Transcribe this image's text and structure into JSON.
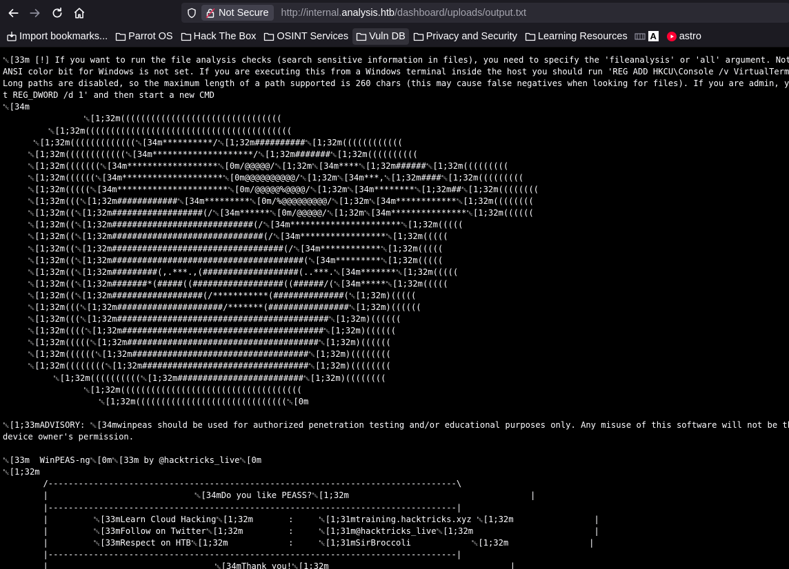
{
  "browser": {
    "security_label": "Not Secure",
    "url_prefix": "http://internal.",
    "url_host": "analysis.htb",
    "url_path": "/dashboard/uploads/output.txt"
  },
  "bookmarks": [
    {
      "label": "Import bookmarks...",
      "icon": "import-icon"
    },
    {
      "label": "Parrot OS",
      "icon": "folder-icon"
    },
    {
      "label": "Hack The Box",
      "icon": "folder-icon"
    },
    {
      "label": "OSINT Services",
      "icon": "folder-icon"
    },
    {
      "label": "Vuln DB",
      "icon": "folder-icon"
    },
    {
      "label": "Privacy and Security",
      "icon": "folder-icon"
    },
    {
      "label": "Learning Resources",
      "icon": "folder-icon"
    },
    {
      "label": "astro",
      "icon": "youtube-icon"
    }
  ],
  "document": {
    "lines": [
      "␛[33m [!] If you want to run the file analysis checks (search sensitive information in files), you need to specify the 'fileanalysis' or 'all' argument. Note this",
      "ANSI color bit for Windows is not set. If you are executing this from a Windows terminal inside the host you should run 'REG ADD HKCU\\Console /v VirtualTerminalLevel",
      "Long paths are disabled, so the maximum length of a path supported is 260 chars (this may cause false negatives when looking for files). If you are admin, you can",
      "t REG_DWORD /d 1' and then start a new CMD",
      "␛[34m",
      "                ␛[1;32m((((((((((((((((((((((((((((((((",
      "         ␛[1;32m(((((((((((((((((((((((((((((((((((((((((",
      "      ␛[1;32m(((((((((((((␛[34m**********/␛[1;32m##########␛[1;32m((((((((((((",
      "     ␛[1;32m((((((((((((␛[34m********************/␛[1;32m#######␛[1;32m((((((((((",
      "     ␛[1;32m(((((((␛[34m******************␛[0m/@@@@@/␛[1;32m␛[34m****␛[1;32m######␛[1;32m(((((((((",
      "     ␛[1;32m((((((␛[34m********************␛[0m@@@@@@@@@@/␛[1;32m␛[34m***,␛[1;32m####␛[1;32m(((((((((",
      "     ␛[1;32m(((((␛[34m**********************␛[0m/@@@@@%@@@@/␛[1;32m␛[34m********␛[1;32m##␛[1;32m((((((((",
      "     ␛[1;32m(((␛[1;32m############␛[34m*********␛[0m/%@@@@@@@@@/␛[1;32m␛[34m************␛[1;32m((((((((",
      "     ␛[1;32m((␛[1;32m##################(/␛[34m******␛[0m/@@@@@/␛[1;32m␛[34m***************␛[1;32m((((((",
      "     ␛[1;32m((␛[1;32m############################(/␛[34m**********************␛[1;32m(((((",
      "     ␛[1;32m((␛[1;32m##############################(/␛[34m*****************␛[1;32m(((((",
      "     ␛[1;32m((␛[1;32m##################################(/␛[34m************␛[1;32m(((((",
      "     ␛[1;32m((␛[1;32m######################################(␛[34m*********␛[1;32m(((((",
      "     ␛[1;32m((␛[1;32m#########(,.***.,(###################(..***.␛[34m*******␛[1;32m(((((",
      "     ␛[1;32m((␛[1;32m#######*(#####((##################((######/(␛[34m*****␛[1;32m(((((",
      "     ␛[1;32m((␛[1;32m##################(/***********(##############(␛[1;32m)(((((",
      "     ␛[1;32m(((␛[1;32m#####################/*******(################␛[1;32m)((((((",
      "     ␛[1;32m(((␛[1;32m##########################################␛[1;32m)((((((",
      "     ␛[1;32m((((␛[1;32m########################################␛[1;32m)((((((",
      "     ␛[1;32m(((((␛[1;32m######################################␛[1;32m)((((((",
      "     ␛[1;32m((((((␛[1;32m###################################␛[1;32m)((((((((",
      "     ␛[1;32m((((((((␛[1;32m#################################␛[1;32m)((((((((",
      "          ␛[1;32m((((((((((␛[1;32m#########################␛[1;32m)((((((((",
      "                ␛[1;32m((((((((((((((((((((((((((((((((((((",
      "                   ␛[1;32m((((((((((((((((((((((((((((((␛[0m",
      "",
      "␛[1;33mADVISORY: ␛[34mwinpeas should be used for authorized penetration testing and/or educational purposes only. Any misuse of this software will not be the respons",
      "device owner's permission.",
      "",
      "␛[33m  WinPEAS-ng␛[0m␛[33m by @hacktricks_live␛[0m",
      "␛[1;32m",
      "        /---------------------------------------------------------------------------------\\",
      "        |                             ␛[34mDo you like PEASS?␛[1;32m                                    |",
      "        |---------------------------------------------------------------------------------|",
      "        |         ␛[33mLearn Cloud Hacking␛[1;32m       :     ␛[1;31mtraining.hacktricks.xyz ␛[1;32m                |",
      "        |         ␛[33mFollow on Twitter␛[1;32m         :     ␛[1;31m@hacktricks_live␛[1;32m                        |",
      "        |         ␛[33mRespect on HTB␛[1;32m            :     ␛[1;31mSirBroccoli            ␛[1;32m                |",
      "        |---------------------------------------------------------------------------------|",
      "        |                                 ␛[34mThank you!␛[1;32m                                    |"
    ]
  }
}
